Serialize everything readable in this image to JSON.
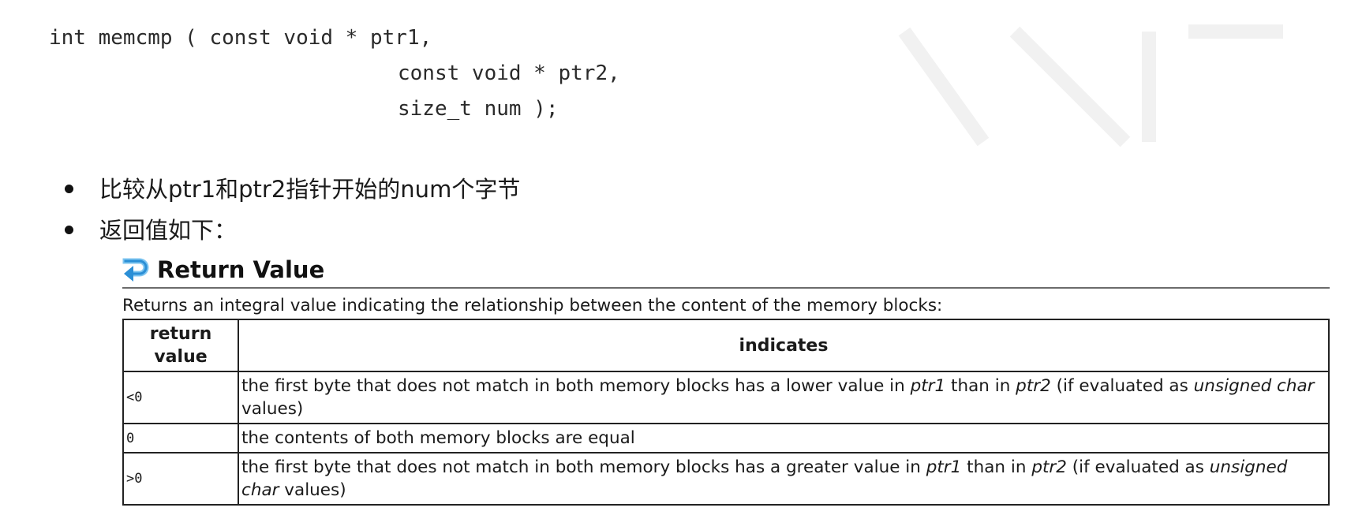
{
  "code": {
    "line1": "int memcmp ( const void * ptr1,",
    "line2": "const void * ptr2,",
    "line3": "size_t num );"
  },
  "bullets": [
    "比较从ptr1和ptr2指针开始的num个字节",
    "返回值如下："
  ],
  "return_value": {
    "icon": "return-arrow-icon",
    "title": "Return Value",
    "description": "Returns an integral value indicating the relationship between the content of the memory blocks:",
    "headers": {
      "col1": "return value",
      "col2": "indicates"
    },
    "rows": [
      {
        "value": "<0",
        "text_a": "the first byte that does not match in both memory blocks has a lower value in ",
        "ptr1": "ptr1",
        "text_b": " than in ",
        "ptr2": "ptr2",
        "text_c": " (if evaluated as ",
        "uchar": "unsigned char",
        "text_d": " values)"
      },
      {
        "value": "0",
        "text": "the contents of both memory blocks are equal"
      },
      {
        "value": ">0",
        "text_a": "the first byte that does not match in both memory blocks has a greater value in ",
        "ptr1": "ptr1",
        "text_b": " than in ",
        "ptr2": "ptr2",
        "text_c": " (if evaluated as ",
        "uchar": "unsigned char",
        "text_d": " values)"
      }
    ]
  },
  "colors": {
    "icon_blue": "#2b8fd6",
    "icon_light": "#7cc4f0"
  }
}
